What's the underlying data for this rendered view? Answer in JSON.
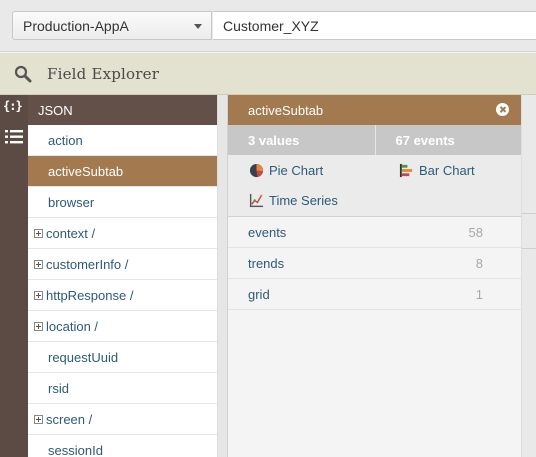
{
  "topbar": {
    "app_selected": "Production-AppA",
    "customer_value": "Customer_XYZ"
  },
  "explorer": {
    "title": "Field Explorer",
    "icon": "search-icon"
  },
  "rail": {
    "json_icon_glyph": "{:}",
    "icons": [
      "json-braces-icon",
      "list-icon"
    ]
  },
  "fields": {
    "header": "JSON",
    "items": [
      {
        "label": "action",
        "expandable": false
      },
      {
        "label": "activeSubtab",
        "expandable": false,
        "selected": true
      },
      {
        "label": "browser",
        "expandable": false
      },
      {
        "label": "context /",
        "expandable": true
      },
      {
        "label": "customerInfo /",
        "expandable": true
      },
      {
        "label": "httpResponse /",
        "expandable": true
      },
      {
        "label": "location /",
        "expandable": true
      },
      {
        "label": "requestUuid",
        "expandable": false
      },
      {
        "label": "rsid",
        "expandable": false
      },
      {
        "label": "screen /",
        "expandable": true
      },
      {
        "label": "sessionId",
        "expandable": false
      }
    ]
  },
  "detail": {
    "title": "activeSubtab",
    "values_count": "3 values",
    "events_count": "67 events",
    "viz": {
      "pie": "Pie Chart",
      "bar": "Bar Chart",
      "timeseries": "Time Series"
    },
    "values": [
      {
        "label": "events",
        "count": "58"
      },
      {
        "label": "trends",
        "count": "8"
      },
      {
        "label": "grid",
        "count": "1"
      }
    ]
  },
  "colors": {
    "accent_brown": "#a37a4f",
    "rail_dark": "#5c4a44",
    "link_blue": "#2c5a78"
  }
}
